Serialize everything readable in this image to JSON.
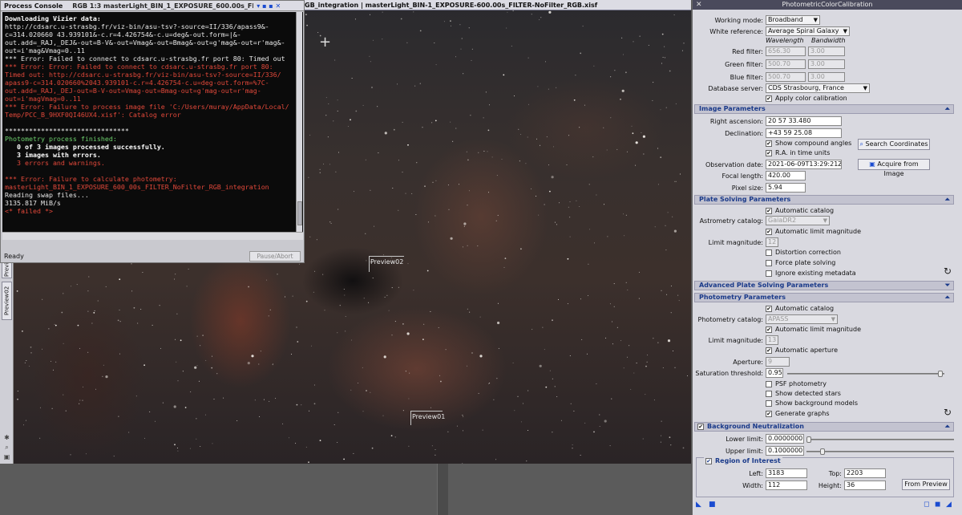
{
  "image_window": {
    "title": "RGB 1:3 masterLight_BIN_1_EXPOSURE_600.00s_FILTER-NoFilter_RGB_integration | masterLight_BIN-1_EXPOSURE-600.00s_FILTER-NoFilter_RGB.xisf",
    "title_visible": "GB_integration | masterLight_BIN-1_EXPOSURE-600.00s_FILTER-NoFilter_RGB.xisf",
    "console_title_tail": "RGB 1:3 masterLight_BIN_1_EXPOSURE_600.00s_FIL",
    "previews": [
      "Preview02",
      "Preview01"
    ],
    "side_tabs": [
      "Previ",
      "Preview02"
    ]
  },
  "console": {
    "title": "Process Console",
    "lines": [
      {
        "t": "Downloading Vizier data:",
        "c": "b"
      },
      {
        "t": "http://cdsarc.u-strasbg.fr/viz-bin/asu-tsv?-source=II/336/apass9&-",
        "c": "w"
      },
      {
        "t": "c=314.020660 43.939101&-c.r=4.426754&-c.u=deg&-out.form=|&-",
        "c": "w"
      },
      {
        "t": "out.add=_RAJ,_DEJ&-out=B-V&-out=Vmag&-out=Bmag&-out=g'mag&-out=r'mag&-",
        "c": "w"
      },
      {
        "t": "out=i'mag&Vmag=0..11",
        "c": "w"
      },
      {
        "t": "*** Error: Failed to connect to cdsarc.u-strasbg.fr port 80: Timed out",
        "c": "w"
      },
      {
        "t": "*** Error: Error: Failed to connect to cdsarc.u-strasbg.fr port 80:",
        "c": "r"
      },
      {
        "t": "Timed out: http://cdsarc.u-strasbg.fr/viz-bin/asu-tsv?-source=II/336/",
        "c": "r"
      },
      {
        "t": "apass9-c=314.020660%2043.939101-c.r=4.426754-c.u=deg-out.form=%7C-",
        "c": "r"
      },
      {
        "t": "out.add=_RAJ,_DEJ-out=B-V-out=Vmag-out=Bmag-out=g'mag-out=r'mag-",
        "c": "r"
      },
      {
        "t": "out=i'magVmag=0..11",
        "c": "r"
      },
      {
        "t": "*** Error: Failure to process image file 'C:/Users/muray/AppData/Local/",
        "c": "r"
      },
      {
        "t": "Temp/PCC_B_9HXF0QI46UX4.xisf': Catalog error",
        "c": "r"
      },
      {
        "t": "",
        "c": "w"
      },
      {
        "t": "*******************************",
        "c": "w"
      },
      {
        "t": "Photometry process finished:",
        "c": "g"
      },
      {
        "t": "   0 of 3 images processed successfully.",
        "c": "b"
      },
      {
        "t": "   3 images with errors.",
        "c": "b"
      },
      {
        "t": "   3 errors and warnings.",
        "c": "r"
      },
      {
        "t": "",
        "c": "w"
      },
      {
        "t": "*** Error: Failure to calculate photometry:",
        "c": "r"
      },
      {
        "t": "masterLight_BIN_1_EXPOSURE_600_00s_FILTER_NoFilter_RGB_integration",
        "c": "r"
      },
      {
        "t": "Reading swap files...",
        "c": "w"
      },
      {
        "t": "3135.817 MiB/s",
        "c": "w"
      },
      {
        "t": "<* failed *>",
        "c": "r"
      }
    ],
    "status": "Ready",
    "pause_button": "Pause/Abort"
  },
  "pcc": {
    "title": "PhotometricColorCalibration",
    "working_mode_label": "Working mode:",
    "working_mode": "Broadband",
    "white_ref_label": "White reference:",
    "white_ref": "Average Spiral Galaxy",
    "col_wavelength": "Wavelength",
    "col_bandwidth": "Bandwidth",
    "filters": [
      {
        "label": "Red filter:",
        "wl": "656.30",
        "bw": "3.00"
      },
      {
        "label": "Green filter:",
        "wl": "500.70",
        "bw": "3.00"
      },
      {
        "label": "Blue filter:",
        "wl": "500.70",
        "bw": "3.00"
      }
    ],
    "db_label": "Database server:",
    "db_value": "CDS Strasbourg, France",
    "apply_cal": "Apply color calibration",
    "image_params": {
      "header": "Image Parameters",
      "ra_label": "Right ascension:",
      "ra": "20 57 33.480",
      "dec_label": "Declination:",
      "dec": "+43 59 25.08",
      "show_compound": "Show compound angles",
      "ra_time": "R.A. in time units",
      "search_btn": "Search Coordinates",
      "obs_label": "Observation date:",
      "obs": "2021-06-09T13:29:21Z",
      "acquire_btn": "Acquire from Image",
      "focal_label": "Focal length:",
      "focal": "420.00",
      "pixel_label": "Pixel size:",
      "pixel": "5.94"
    },
    "plate": {
      "header": "Plate Solving Parameters",
      "auto_cat": "Automatic catalog",
      "astro_label": "Astrometry catalog:",
      "astro": "GaiaDR2",
      "auto_limit": "Automatic limit magnitude",
      "limit_label": "Limit magnitude:",
      "limit": "12",
      "distortion": "Distortion correction",
      "force": "Force plate solving",
      "ignore_meta": "Ignore existing metadata"
    },
    "adv_plate": {
      "header": "Advanced Plate Solving Parameters"
    },
    "photometry": {
      "header": "Photometry Parameters",
      "auto_cat": "Automatic catalog",
      "cat_label": "Photometry catalog:",
      "cat": "APASS",
      "auto_limit": "Automatic limit magnitude",
      "limit_label": "Limit magnitude:",
      "limit": "13",
      "auto_aperture": "Automatic aperture",
      "aperture_label": "Aperture:",
      "aperture": "9",
      "sat_label": "Saturation threshold:",
      "sat": "0.95",
      "psf": "PSF photometry",
      "show_stars": "Show detected stars",
      "show_bg": "Show background models",
      "gen_graphs": "Generate graphs"
    },
    "bg": {
      "header": "Background Neutralization",
      "lower_label": "Lower limit:",
      "lower": "0.0000000",
      "upper_label": "Upper limit:",
      "upper": "0.1000000",
      "roi_header": "Region of Interest",
      "left_label": "Left:",
      "left": "3183",
      "top_label": "Top:",
      "top": "2203",
      "width_label": "Width:",
      "width": "112",
      "height_label": "Height:",
      "height": "36",
      "from_preview": "From Preview"
    }
  }
}
